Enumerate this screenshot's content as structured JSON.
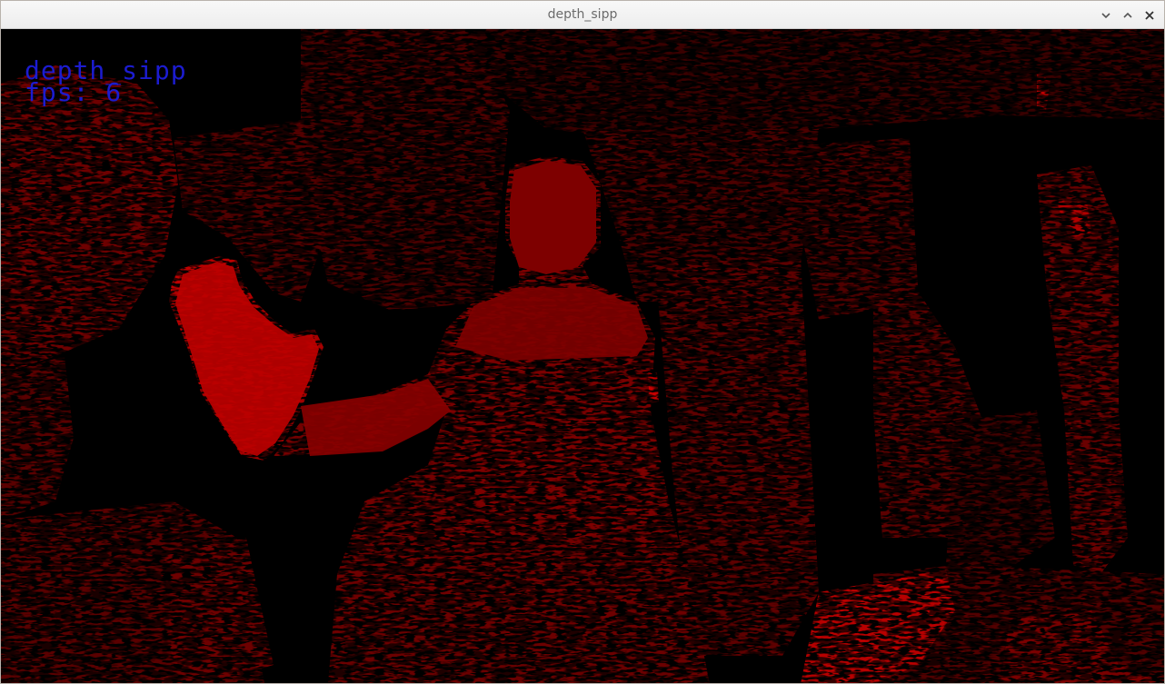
{
  "window": {
    "title": "depth_sipp",
    "controls": [
      "minimize-icon",
      "maximize-icon",
      "close-icon"
    ]
  },
  "overlay": {
    "window_name": "depth_sipp",
    "fps_text": "fps: 6"
  },
  "colors": {
    "overlay_text": "#1c1cd0",
    "depth_near": "#c00000",
    "depth_mid": "#7a0000",
    "depth_far": "#3a0000",
    "invalid": "#000000"
  }
}
